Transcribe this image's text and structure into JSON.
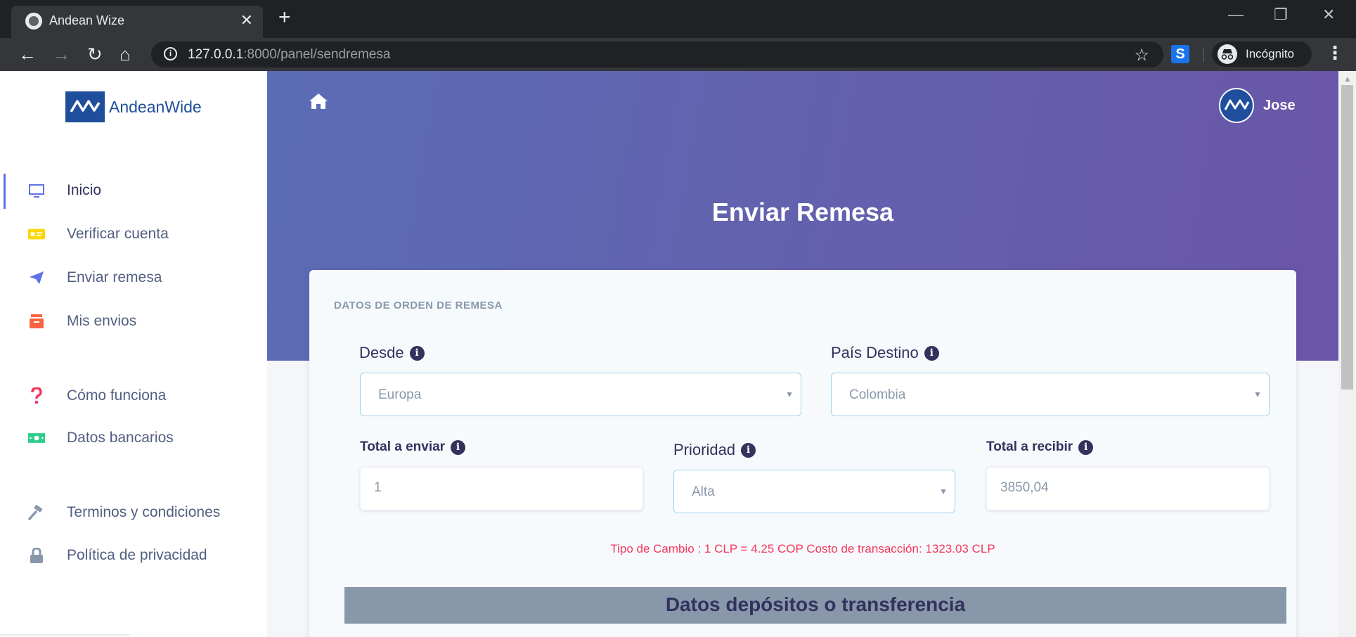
{
  "browser": {
    "tab_title": "Andean Wize",
    "close_glyph": "✕",
    "new_tab_glyph": "+",
    "url_host": "127.0.0.1",
    "url_rest": ":8000/panel/sendremesa",
    "incognito_label": "Incógnito",
    "extension_label": "S",
    "window_controls": {
      "minimize": "—",
      "restore": "❐",
      "close": "✕"
    },
    "nav": {
      "back": "←",
      "forward": "→",
      "reload": "↻",
      "home": "⌂",
      "star": "☆",
      "menu": "⋮"
    }
  },
  "sidebar": {
    "brand": "AndeanWide",
    "items": [
      {
        "label": "Inicio",
        "icon": "monitor-icon",
        "active": true
      },
      {
        "label": "Verificar cuenta",
        "icon": "id-card-icon",
        "color": "#ffd600"
      },
      {
        "label": "Enviar remesa",
        "icon": "paper-plane-icon",
        "color": "#5e72e4"
      },
      {
        "label": "Mis envios",
        "icon": "archive-icon",
        "color": "#fb6340"
      },
      {
        "label": "Cómo funciona",
        "icon": "question-icon",
        "color": "#f5365c"
      },
      {
        "label": "Datos bancarios",
        "icon": "money-icon",
        "color": "#2dce89"
      },
      {
        "label": "Terminos y condiciones",
        "icon": "gavel-icon",
        "color": "#8898aa"
      },
      {
        "label": "Política de privacidad",
        "icon": "lock-icon",
        "color": "#8898aa"
      }
    ]
  },
  "header": {
    "username": "Jose",
    "page_title": "Enviar Remesa"
  },
  "form": {
    "section_title": "DATOS DE ORDEN DE REMESA",
    "desde": {
      "label": "Desde",
      "value": "Europa"
    },
    "pais_destino": {
      "label": "País Destino",
      "value": "Colombia"
    },
    "total_enviar": {
      "label": "Total a enviar",
      "value": "1"
    },
    "prioridad": {
      "label": "Prioridad",
      "value": "Alta"
    },
    "total_recibir": {
      "label": "Total a recibir",
      "value": "3850,04"
    },
    "rate_text": "Tipo de Cambio : 1 CLP = 4.25 COP Costo de transacción: 1323.03 CLP",
    "deposit_section_title": "Datos depósitos o transferencia",
    "info_glyph": "i",
    "caret_glyph": "▼"
  }
}
